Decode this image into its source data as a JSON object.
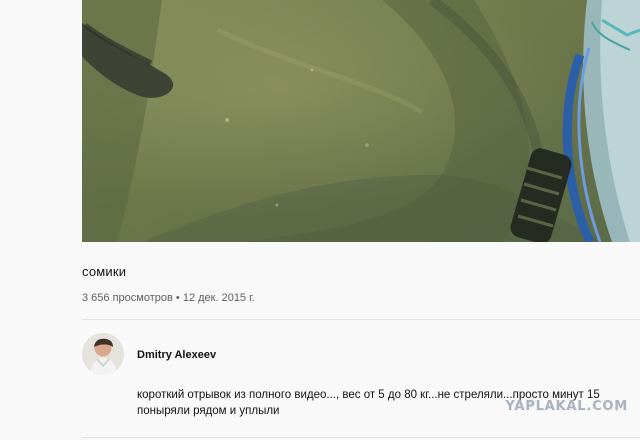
{
  "video": {
    "title": "сомики",
    "views": "3 656 просмотров",
    "separator": "•",
    "date": "12 дек. 2015 г."
  },
  "owner": {
    "channel_name": "Dmitry Alexeev"
  },
  "description": {
    "text": "короткий отрывок из полного видео..., вес от 5 до 80 кг...не стреляли...просто минут 15 поныряли рядом и уплыли"
  },
  "watermark": {
    "text": "YAPLAKAL.COM"
  },
  "colors": {
    "page_background": "#f9f9f9",
    "underwater_green": "#6f7845",
    "muted_text": "#606060",
    "watermark": "#a9b2bd"
  }
}
